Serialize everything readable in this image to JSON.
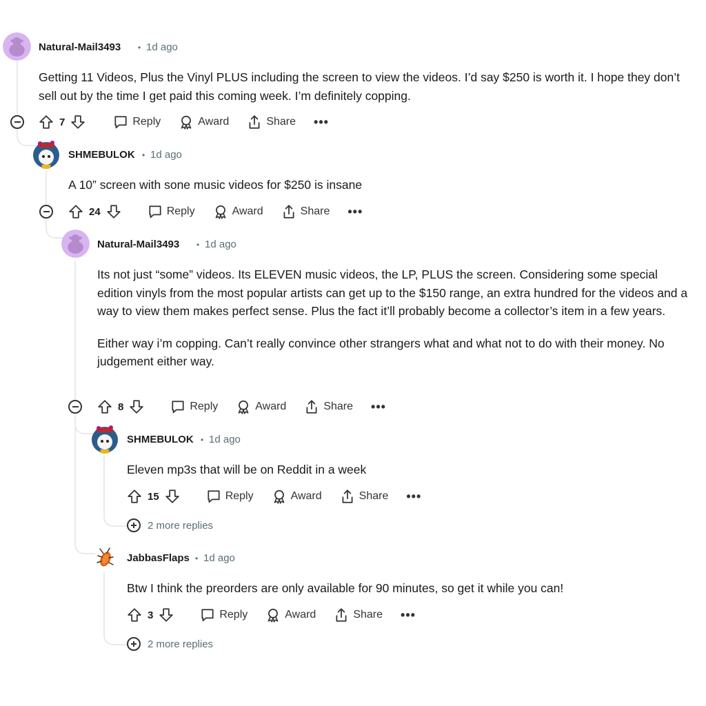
{
  "comments": [
    {
      "author": "Natural-Mail3493",
      "time": "1d ago",
      "body": [
        "Getting 11 Videos, Plus the Vinyl PLUS including the screen to view the videos. I’d say $250 is worth it. I hope they don’t sell out by the time I get paid this coming week. I’m definitely copping."
      ],
      "score": "7"
    },
    {
      "author": "SHMEBULOK",
      "time": "1d ago",
      "body": [
        "A 10” screen with sone music videos for $250 is insane"
      ],
      "score": "24"
    },
    {
      "author": "Natural-Mail3493",
      "time": "1d ago",
      "body": [
        "Its not just “some” videos. Its ELEVEN music videos, the LP, PLUS the screen. Considering some special edition vinyls from the most popular artists can get up to the $150 range, an extra hundred for the videos and a way to view them makes perfect sense. Plus the fact it’ll probably become a collector’s item in a few years.",
        "Either way i’m copping. Can’t really convince other strangers what and what not to do with their money. No judgement either way."
      ],
      "score": "8"
    },
    {
      "author": "SHMEBULOK",
      "time": "1d ago",
      "body": [
        "Eleven mp3s that will be on Reddit in a week"
      ],
      "score": "15",
      "more_replies": "2 more replies"
    },
    {
      "author": "JabbasFlaps",
      "time": "1d ago",
      "body": [
        "Btw I think the preorders are only available for 90 minutes, so get it while you can!"
      ],
      "score": "3",
      "more_replies": "2 more replies"
    }
  ],
  "actions": {
    "reply": "Reply",
    "award": "Award",
    "share": "Share",
    "more": "•••",
    "separator": "•"
  },
  "icons": [
    "upvote-icon",
    "downvote-icon",
    "reply-icon",
    "award-icon",
    "share-icon",
    "overflow-icon",
    "collapse-icon",
    "expand-icon"
  ],
  "colors": {
    "meta": "#576f76",
    "thread_line": "#e5ebee",
    "default_avatar": "#d0a8e8"
  }
}
